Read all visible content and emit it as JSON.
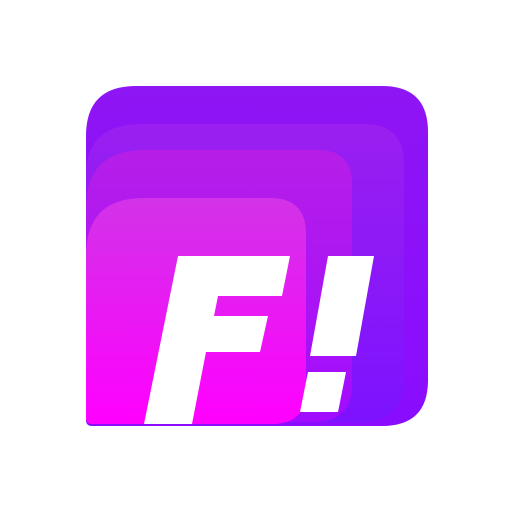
{
  "icon": {
    "name": "F! app icon",
    "glyph_text": "F!",
    "colors": {
      "background": "#ffffff",
      "outer_top": "#8e15f4",
      "outer_bottom": "#8a0cff",
      "layer_1_top": "#9a1ff0",
      "layer_1_bottom": "#7d12ff",
      "layer_2_top": "#b61ee8",
      "layer_2_bottom": "#a10cff",
      "front_top": "#d233e8",
      "front_bottom": "#ff00ff",
      "glyph": "#ffffff"
    }
  }
}
